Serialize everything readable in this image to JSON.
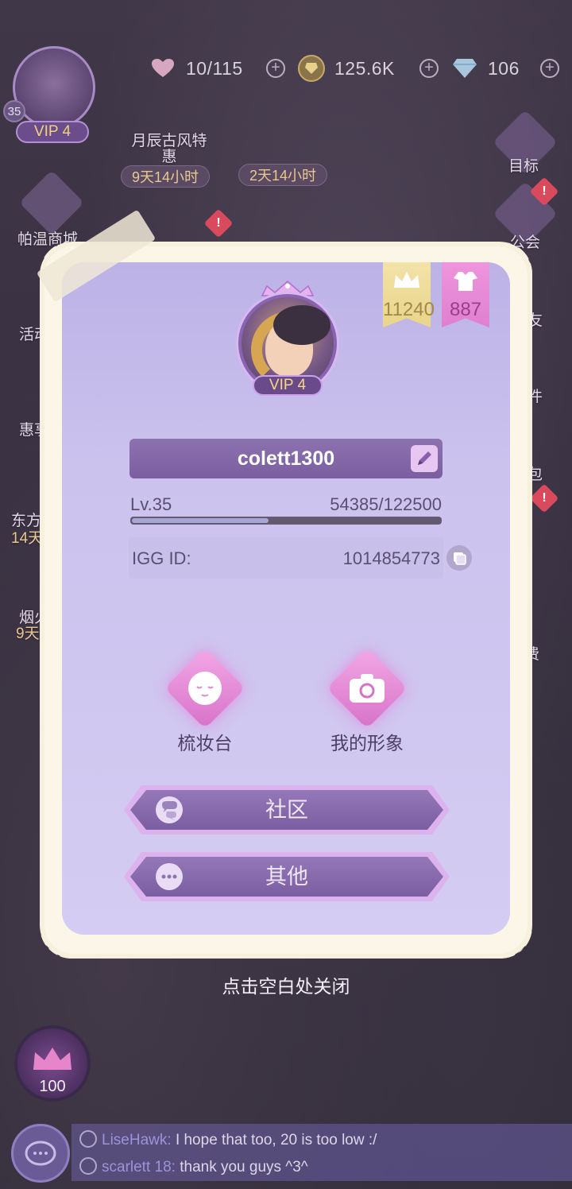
{
  "hud": {
    "level": "35",
    "vip": "VIP 4",
    "hearts": "10/115",
    "coins": "125.6K",
    "gems": "106",
    "plus": "+"
  },
  "side": {
    "promo1_title": "月辰古风特惠",
    "promo1_timer": "9天14小时",
    "promo2_timer": "2天14小时",
    "shop": "帕温商城",
    "activity": "活动",
    "gift": "惠享",
    "east": "东方",
    "east_timer": "14天",
    "fireworks": "烟火",
    "fireworks_timer": "9天",
    "goal": "目标",
    "guild": "公会",
    "friend": "友",
    "mail": "件",
    "bag": "包",
    "pay": "费",
    "badge_mark": "!"
  },
  "profile": {
    "crown_count": "11240",
    "dress_count": "887",
    "vip": "VIP 4",
    "username": "colett1300",
    "level_label": "Lv.35",
    "exp_text": "54385/122500",
    "exp_fraction": 0.444,
    "igg_label": "IGG ID:",
    "igg_id": "1014854773",
    "vanity_label": "梳妆台",
    "image_label": "我的形象",
    "community_label": "社区",
    "other_label": "其他"
  },
  "close_hint": "点击空白处关闭",
  "bottom_badge": "100",
  "chat": [
    {
      "user": "LiseHawk:",
      "msg": "I hope that too, 20 is too low :/"
    },
    {
      "user": "scarlett 18:",
      "msg": "thank you guys ^3^"
    }
  ],
  "colors": {
    "modal_bg": "#cbc2ee",
    "accent_purple": "#7b5ea2",
    "gold": "#f0d27a",
    "pink": "#e07fd0"
  }
}
